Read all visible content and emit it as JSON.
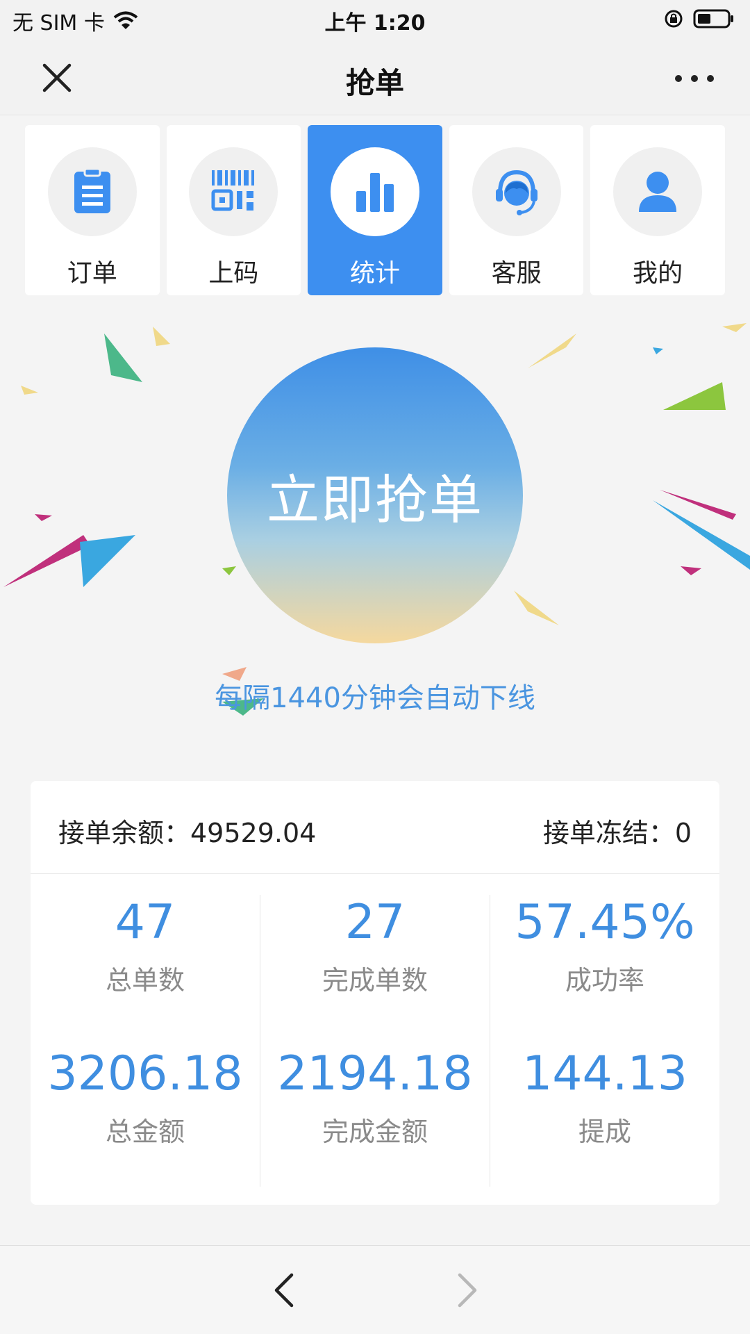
{
  "status_bar": {
    "carrier": "无 SIM 卡",
    "time": "上午 1:20"
  },
  "nav": {
    "title": "抢单"
  },
  "menu": [
    {
      "label": "订单",
      "icon": "clipboard-icon",
      "active": false
    },
    {
      "label": "上码",
      "icon": "qrcode-icon",
      "active": false
    },
    {
      "label": "统计",
      "icon": "bar-chart-icon",
      "active": true
    },
    {
      "label": "客服",
      "icon": "headset-icon",
      "active": false
    },
    {
      "label": "我的",
      "icon": "user-icon",
      "active": false
    }
  ],
  "grab": {
    "button_label": "立即抢单",
    "notice": "每隔1440分钟会自动下线"
  },
  "summary": {
    "balance": "接单余额：49529.04",
    "frozen": "接单冻结：0"
  },
  "stats": [
    {
      "value": "47",
      "label": "总单数"
    },
    {
      "value": "27",
      "label": "完成单数"
    },
    {
      "value": "57.45%",
      "label": "成功率"
    },
    {
      "value": "3206.18",
      "label": "总金额"
    },
    {
      "value": "2194.18",
      "label": "完成金额"
    },
    {
      "value": "144.13",
      "label": "提成"
    }
  ],
  "colors": {
    "accent": "#3d8ff0",
    "stat_value": "#3f8ee0",
    "notice": "#4a95e0"
  }
}
